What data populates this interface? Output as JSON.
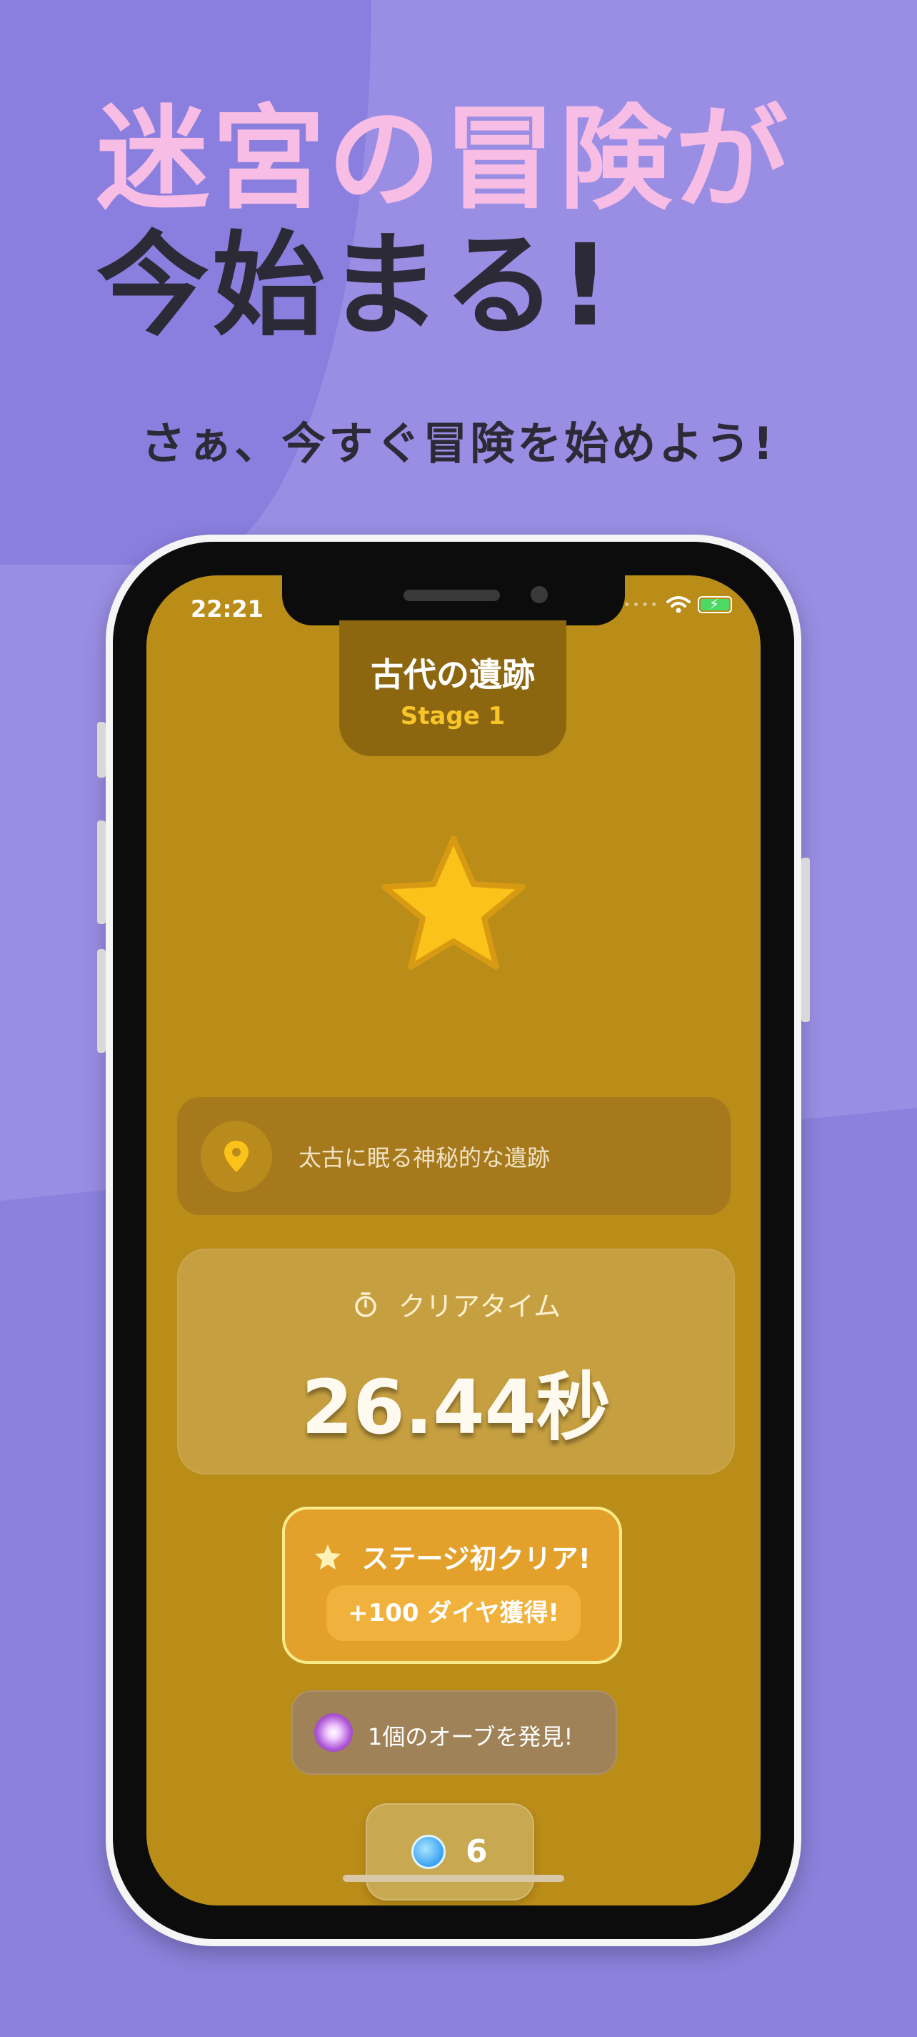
{
  "hero": {
    "line1": "迷宮の冒険が",
    "line2": "今始まる!",
    "subtitle": "さぁ、今すぐ冒険を始めよう!"
  },
  "status_bar": {
    "time": "22:21"
  },
  "stage": {
    "name": "古代の遺跡",
    "number": "Stage 1"
  },
  "location": {
    "icon": "map-pin-icon",
    "description": "太古に眠る神秘的な遺跡"
  },
  "clear_time": {
    "label": "クリアタイム",
    "value": "26.44秒"
  },
  "reward": {
    "title": "ステージ初クリア!",
    "bonus": "+100 ダイヤ獲得!"
  },
  "orb": {
    "text": "1個のオーブを発見!"
  },
  "gems": {
    "count": "6"
  },
  "colors": {
    "background": "#9a8ee4",
    "hero_pink": "#f7bde4",
    "screen_gold": "#ba8c18",
    "star_yellow": "#fbc21a"
  }
}
